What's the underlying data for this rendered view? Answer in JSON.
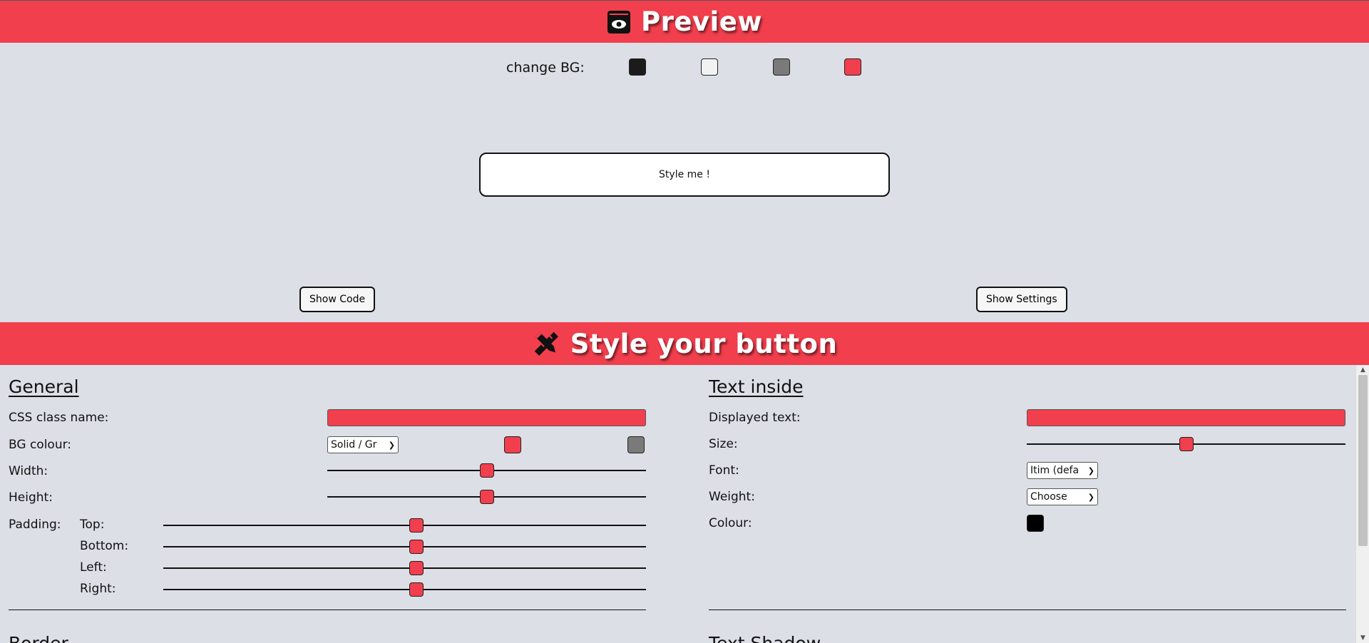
{
  "preview_section": {
    "title": "Preview",
    "icon": "eye-icon"
  },
  "bg_switcher": {
    "label": "change BG:",
    "swatches": [
      "#1b1b1b",
      "#f2f2f2",
      "#7a7a7a",
      "#f13f4d"
    ]
  },
  "demo_button": {
    "label": "Style me !"
  },
  "controls": {
    "show_code": "Show Code",
    "show_settings": "Show Settings"
  },
  "style_section": {
    "title": "Style your button",
    "icon": "pencil-ruler-icon"
  },
  "general": {
    "heading": "General",
    "css_class_label": "CSS class name:",
    "bg_colour_label": "BG colour:",
    "bg_mode_value": "Solid / Gr",
    "bg_colour_1": "#f13f4d",
    "bg_colour_2": "#7a7a7a",
    "width_label": "Width:",
    "width_value": 0.5,
    "height_label": "Height:",
    "height_value": 0.5,
    "padding_label": "Padding:",
    "padding": [
      {
        "label": "Top:",
        "value": 0.525
      },
      {
        "label": "Bottom:",
        "value": 0.525
      },
      {
        "label": "Left:",
        "value": 0.525
      },
      {
        "label": "Right:",
        "value": 0.525
      }
    ],
    "next_heading": "Border"
  },
  "text_inside": {
    "heading": "Text inside",
    "displayed_text_label": "Displayed text:",
    "size_label": "Size:",
    "size_value": 0.5,
    "font_label": "Font:",
    "font_value": "Itim (defa",
    "weight_label": "Weight:",
    "weight_value": "Choose",
    "colour_label": "Colour:",
    "colour_value": "#000000",
    "next_heading": "Text Shadow"
  },
  "colors": {
    "accent": "#f13f4d",
    "background": "#dcdfe6"
  }
}
